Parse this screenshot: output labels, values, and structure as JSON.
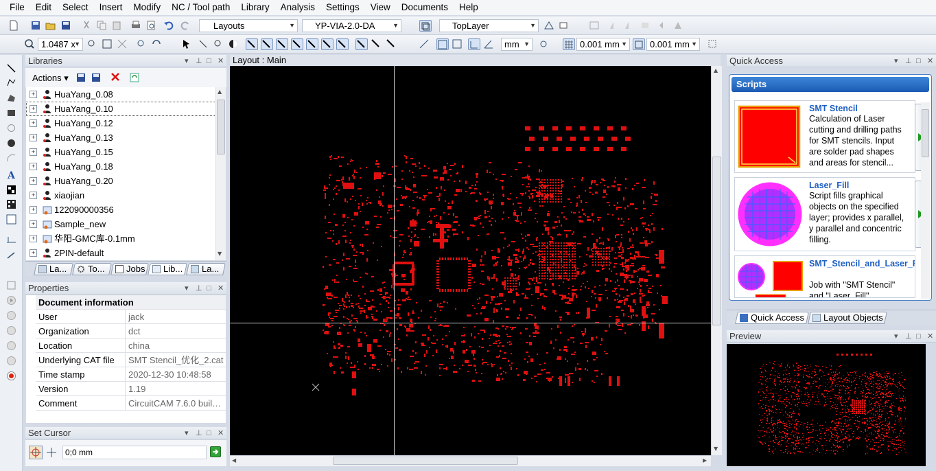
{
  "menu": [
    "File",
    "Edit",
    "Select",
    "Insert",
    "Modify",
    "NC / Tool path",
    "Library",
    "Analysis",
    "Settings",
    "View",
    "Documents",
    "Help"
  ],
  "toolbar": {
    "layouts_combo": "Layouts",
    "layout_combo": "YP-VIA-2.0-DA",
    "layer_combo": "TopLayer",
    "zoom_combo": "1.0487 x",
    "unit_combo": "mm",
    "grid_x": "0.001 mm",
    "grid_y": "0.001 mm"
  },
  "libraries": {
    "title": "Libraries",
    "actions_label": "Actions",
    "items": [
      {
        "label": "HuaYang_0.08",
        "selected": false,
        "icon": "person-icon"
      },
      {
        "label": "HuaYang_0.10",
        "selected": true,
        "icon": "person-icon"
      },
      {
        "label": "HuaYang_0.12",
        "selected": false,
        "icon": "person-icon"
      },
      {
        "label": "HuaYang_0.13",
        "selected": false,
        "icon": "person-icon"
      },
      {
        "label": "HuaYang_0.15",
        "selected": false,
        "icon": "person-icon"
      },
      {
        "label": "HuaYang_0.18",
        "selected": false,
        "icon": "person-icon"
      },
      {
        "label": "HuaYang_0.20",
        "selected": false,
        "icon": "person-icon"
      },
      {
        "label": "xiaojian",
        "selected": false,
        "icon": "person-icon"
      },
      {
        "label": "122090000356",
        "selected": false,
        "icon": "library-icon"
      },
      {
        "label": "Sample_new",
        "selected": false,
        "icon": "library-icon"
      },
      {
        "label": "华阳-GMC库-0.1mm",
        "selected": false,
        "icon": "library-icon"
      },
      {
        "label": "2PIN-default",
        "selected": false,
        "icon": "person-icon"
      }
    ],
    "tabs": [
      "La...",
      "To...",
      "Jobs",
      "Lib...",
      "La..."
    ]
  },
  "properties": {
    "title": "Properties",
    "section": "Document information",
    "rows": [
      {
        "key": "User",
        "value": "jack"
      },
      {
        "key": "Organization",
        "value": "dct"
      },
      {
        "key": "Location",
        "value": "china"
      },
      {
        "key": "Underlying CAT file",
        "value": "SMT Stencil_优化_2.cat"
      },
      {
        "key": "Time stamp",
        "value": "2020-12-30 10:48:58"
      },
      {
        "key": "Version",
        "value": "1.19"
      },
      {
        "key": "Comment",
        "value": "CircuitCAM 7.6.0 build ..."
      }
    ]
  },
  "set_cursor": {
    "title": "Set Cursor",
    "value": "0;0 mm"
  },
  "layout": {
    "title": "Layout : Main"
  },
  "quick_access": {
    "title": "Quick Access",
    "scripts_header": "Scripts",
    "scripts": [
      {
        "name": "SMT Stencil",
        "desc": "Calculation of Laser cutting and drilling paths for SMT stencils. Input are solder pad shapes and areas for stencil..."
      },
      {
        "name": "Laser_Fill",
        "desc": "Script fills graphical objects on the specified layer; provides x parallel, y parallel and concentric filling."
      },
      {
        "name": "SMT_Stencil_and_Laser_Fill",
        "desc": "Job with \"SMT Stencil\" and \"Laser_Fill\""
      }
    ],
    "tabs": [
      "Quick Access",
      "Layout Objects"
    ]
  },
  "preview": {
    "title": "Preview"
  },
  "colors": {
    "pad": "#e01010",
    "canvas": "#000000",
    "accent": "#1b5bb5"
  }
}
